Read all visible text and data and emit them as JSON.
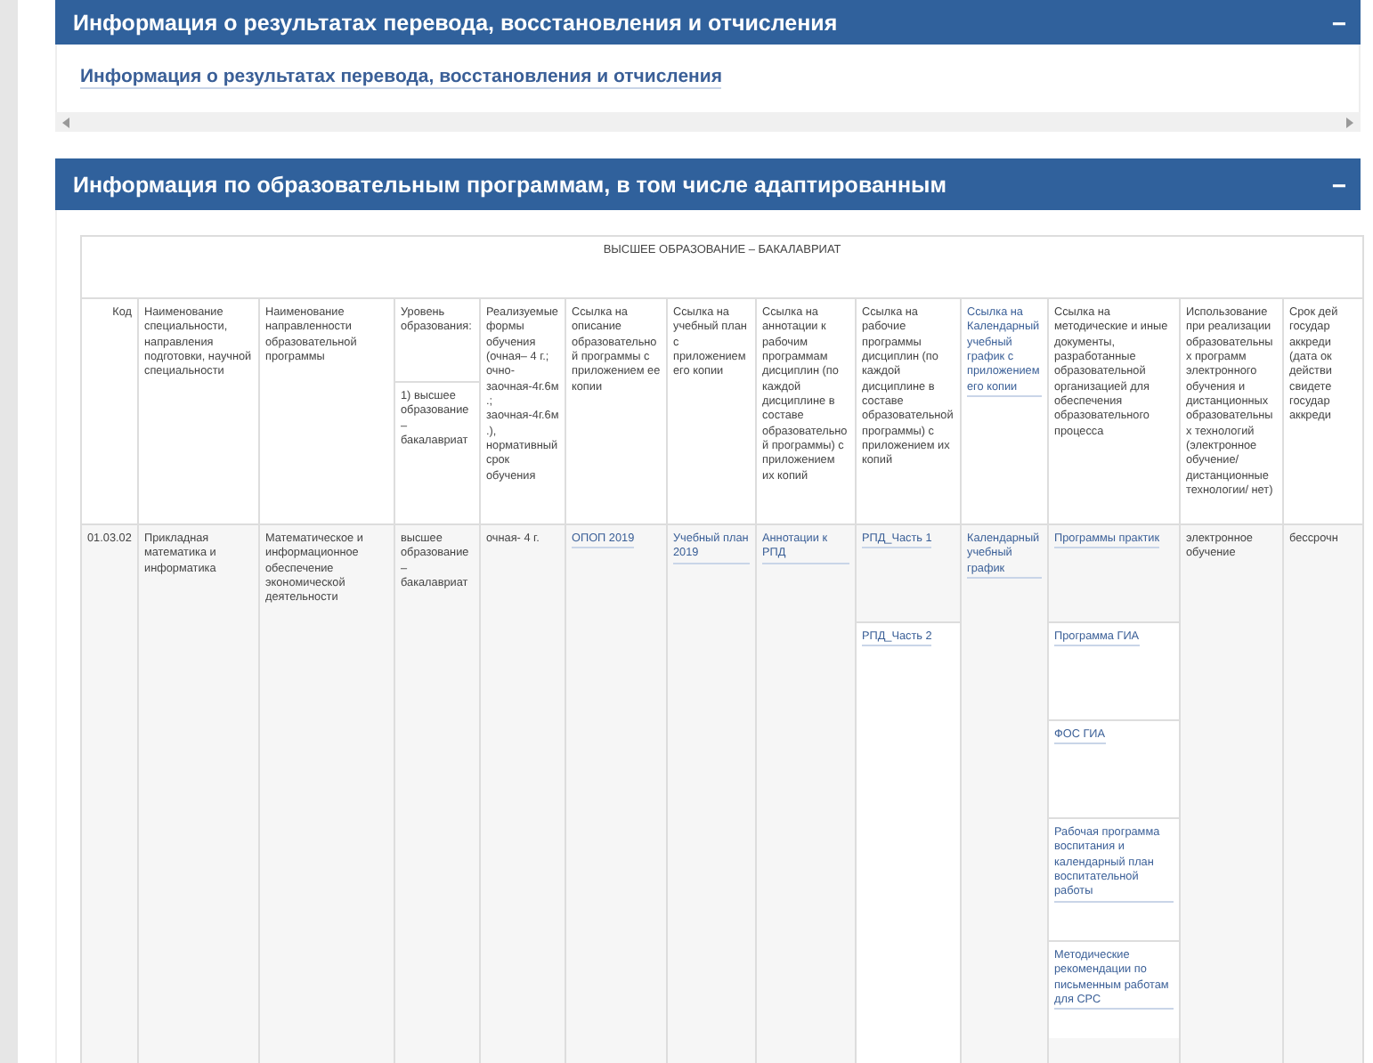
{
  "panels": [
    {
      "title": "Информация о результатах перевода, восстановления и отчисления",
      "toggle": "−",
      "links": [
        "Информация о результатах перевода, восстановления и отчисления"
      ]
    },
    {
      "title": "Информация по образовательным программам, в том числе адаптированным",
      "toggle": "−",
      "table": {
        "caption": "ВЫСШЕЕ ОБРАЗОВАНИЕ – БАКАЛАВРИАТ",
        "columns": [
          {
            "text": "Код",
            "link": false
          },
          {
            "text": "Наименование специальности, направления подготовки, научной специальности",
            "link": false
          },
          {
            "text": "Наименование направленности образовательной программы",
            "link": false
          },
          {
            "text": "Уровень образования:",
            "link": false,
            "sub": "1) высшее образование – бакалавриат"
          },
          {
            "text": "Реализуемые формы обучения (очная– 4 г.; очно-заочная-4г.6м.; заочная-4г.6м.), нормативный срок обучения",
            "link": false
          },
          {
            "text": "Ссылка на описание образовательной программы с приложением ее копии",
            "link": false
          },
          {
            "text": "Ссылка на учебный план с приложением его копии",
            "link": false
          },
          {
            "text": "Ссылка на аннотации к рабочим программам дисциплин (по каждой дисциплине в составе образовательной программы) с приложением их копий",
            "link": false
          },
          {
            "text": "Ссылка на рабочие программы дисциплин (по каждой дисциплине в составе образовательной программы) с приложением их копий",
            "link": false
          },
          {
            "text": "Ссылка на Календарный учебный график с приложением его копии",
            "link": true
          },
          {
            "text": "Ссылка на методические и иные документы, разработанные образовательной организацией для обеспечения образовательного процесса",
            "link": false
          },
          {
            "text": "Использование при реализации образовательных программ электронного обучения и дистанционных образовательных технологий (электронное обучение/ дистанционные технологии/ нет)",
            "link": false
          },
          {
            "text": "Срок дей\nгосудар\nаккреди\n(дата ок\nдействи\nсвидете\nгосудар\nаккреди",
            "link": false
          }
        ],
        "rows": [
          {
            "cells": [
              {
                "link": false,
                "items": [
                  "01.03.02"
                ]
              },
              {
                "link": false,
                "items": [
                  "Прикладная математика и информатика"
                ]
              },
              {
                "link": false,
                "items": [
                  "Математическое и информационное обеспечение экономической деятельности"
                ]
              },
              {
                "link": false,
                "items": [
                  "высшее образование – бакалавриат"
                ]
              },
              {
                "link": false,
                "items": [
                  "очная- 4 г."
                ]
              },
              {
                "link": true,
                "items": [
                  "ОПОП 2019"
                ]
              },
              {
                "link": true,
                "items": [
                  "Учебный план 2019"
                ]
              },
              {
                "link": true,
                "items": [
                  "Аннотации к РПД"
                ]
              },
              {
                "link": true,
                "items": [
                  "РПД_Часть 1",
                  "РПД_Часть 2"
                ]
              },
              {
                "link": true,
                "items": [
                  "Календарный учебный график"
                ]
              },
              {
                "link": true,
                "items": [
                  "Программы практик",
                  "Программа ГИА",
                  "ФОС ГИА",
                  "Рабочая программа воспитания и календарный план воспитательной работы",
                  "Методические рекомендации по письменным работам для СРС"
                ]
              },
              {
                "link": false,
                "items": [
                  "электронное обучение"
                ]
              },
              {
                "link": false,
                "items": [
                  "бессрочн"
                ]
              }
            ]
          }
        ]
      }
    }
  ]
}
